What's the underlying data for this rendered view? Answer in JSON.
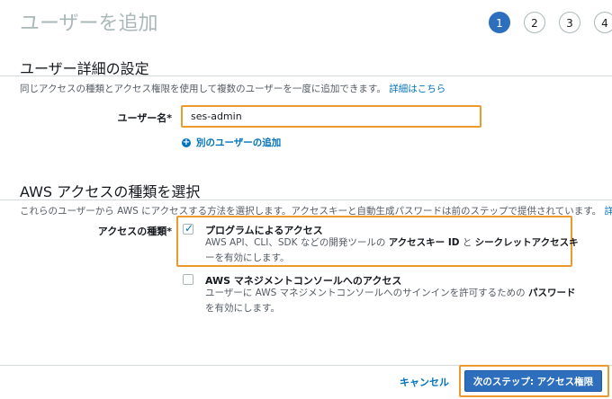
{
  "page": {
    "title": "ユーザーを追加"
  },
  "steps": [
    "1",
    "2",
    "3",
    "4"
  ],
  "details": {
    "title": "ユーザー詳細の設定",
    "description": "同じアクセスの種類とアクセス権限を使用して複数のユーザーを一度に追加できます。",
    "learn_more": "詳細はこちら",
    "username_label": "ユーザー名*",
    "username_value": "ses-admin",
    "add_user_label": "別のユーザーの追加"
  },
  "access": {
    "title": "AWS アクセスの種類を選択",
    "description": "これらのユーザーから AWS にアクセスする方法を選択します。アクセスキーと自動生成パスワードは前のステップで提供されています。",
    "learn_more": "詳細",
    "type_label": "アクセスの種類*",
    "programmatic": {
      "title": "プログラムによるアクセス",
      "desc_1a": "AWS API、CLI、SDK などの開発ツールの",
      "desc_1b": "アクセスキー ID",
      "desc_1c": "と",
      "desc_1d": "シークレットアクセスキ",
      "desc_2": "ーを有効にします。",
      "checked": true
    },
    "console": {
      "title": "AWS マネジメントコンソールへのアクセス",
      "desc_1a": "ユーザーに AWS マネジメントコンソールへのサインインを許可するための",
      "desc_1b": "パスワード",
      "desc_2": "を有効にします。",
      "checked": false
    }
  },
  "footer": {
    "cancel_label": "キャンセル",
    "next_label": "次のステップ: アクセス権限"
  },
  "colors": {
    "accent": "#2e6fbd",
    "highlight": "#ec9a2f",
    "link": "#0073bb"
  }
}
